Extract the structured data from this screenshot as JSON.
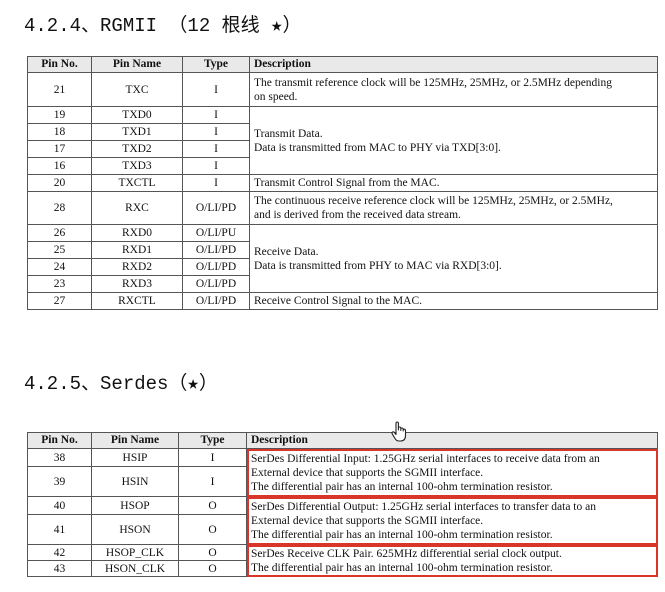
{
  "section1": {
    "heading": "4.2.4、RGMII （12 根线 ★）",
    "headers": [
      "Pin No.",
      "Pin Name",
      "Type",
      "Description"
    ],
    "rows": [
      {
        "no": "21",
        "name": "TXC",
        "type": "I"
      },
      {
        "no": "19",
        "name": "TXD0",
        "type": "I"
      },
      {
        "no": "18",
        "name": "TXD1",
        "type": "I"
      },
      {
        "no": "17",
        "name": "TXD2",
        "type": "I"
      },
      {
        "no": "16",
        "name": "TXD3",
        "type": "I"
      },
      {
        "no": "20",
        "name": "TXCTL",
        "type": "I"
      },
      {
        "no": "28",
        "name": "RXC",
        "type": "O/LI/PD"
      },
      {
        "no": "26",
        "name": "RXD0",
        "type": "O/LI/PU"
      },
      {
        "no": "25",
        "name": "RXD1",
        "type": "O/LI/PD"
      },
      {
        "no": "24",
        "name": "RXD2",
        "type": "O/LI/PD"
      },
      {
        "no": "23",
        "name": "RXD3",
        "type": "O/LI/PD"
      },
      {
        "no": "27",
        "name": "RXCTL",
        "type": "O/LI/PD"
      }
    ],
    "descriptions": {
      "txc": [
        "The transmit reference clock will be 125MHz, 25MHz, or 2.5MHz depending",
        "on speed."
      ],
      "txd": [
        "Transmit Data.",
        "Data is transmitted from MAC to PHY via TXD[3:0]."
      ],
      "txctl": [
        "Transmit Control Signal from the MAC."
      ],
      "rxc": [
        "The continuous receive reference clock will be 125MHz, 25MHz, or 2.5MHz,",
        "and is derived from the received data stream."
      ],
      "rxd": [
        "Receive Data.",
        "Data is transmitted from PHY to MAC via RXD[3:0]."
      ],
      "rxctl": [
        "Receive Control Signal to the MAC."
      ]
    }
  },
  "section2": {
    "heading": "4.2.5、Serdes（★）",
    "headers": [
      "Pin No.",
      "Pin Name",
      "Type",
      "Description"
    ],
    "rows": [
      {
        "no": "38",
        "name": "HSIP",
        "type": "I"
      },
      {
        "no": "39",
        "name": "HSIN",
        "type": "I"
      },
      {
        "no": "40",
        "name": "HSOP",
        "type": "O"
      },
      {
        "no": "41",
        "name": "HSON",
        "type": "O"
      },
      {
        "no": "42",
        "name": "HSOP_CLK",
        "type": "O"
      },
      {
        "no": "43",
        "name": "HSON_CLK",
        "type": "O"
      }
    ],
    "descriptions": {
      "hsi": [
        "SerDes Differential Input: 1.25GHz serial interfaces to receive data from an",
        "External device that supports the SGMII interface.",
        "The differential pair has an internal 100-ohm termination resistor."
      ],
      "hso": [
        "SerDes Differential Output: 1.25GHz serial interfaces to transfer data to an",
        "External device that supports the SGMII interface.",
        "The differential pair has an internal 100-ohm termination resistor."
      ],
      "clk": [
        "SerDes Receive CLK Pair. 625MHz differential serial clock output.",
        "The differential pair has an internal 100-ohm termination resistor."
      ]
    }
  },
  "colors": {
    "highlight": "#d9362b",
    "header_bg": "#e9e9e9",
    "border": "#555555"
  }
}
